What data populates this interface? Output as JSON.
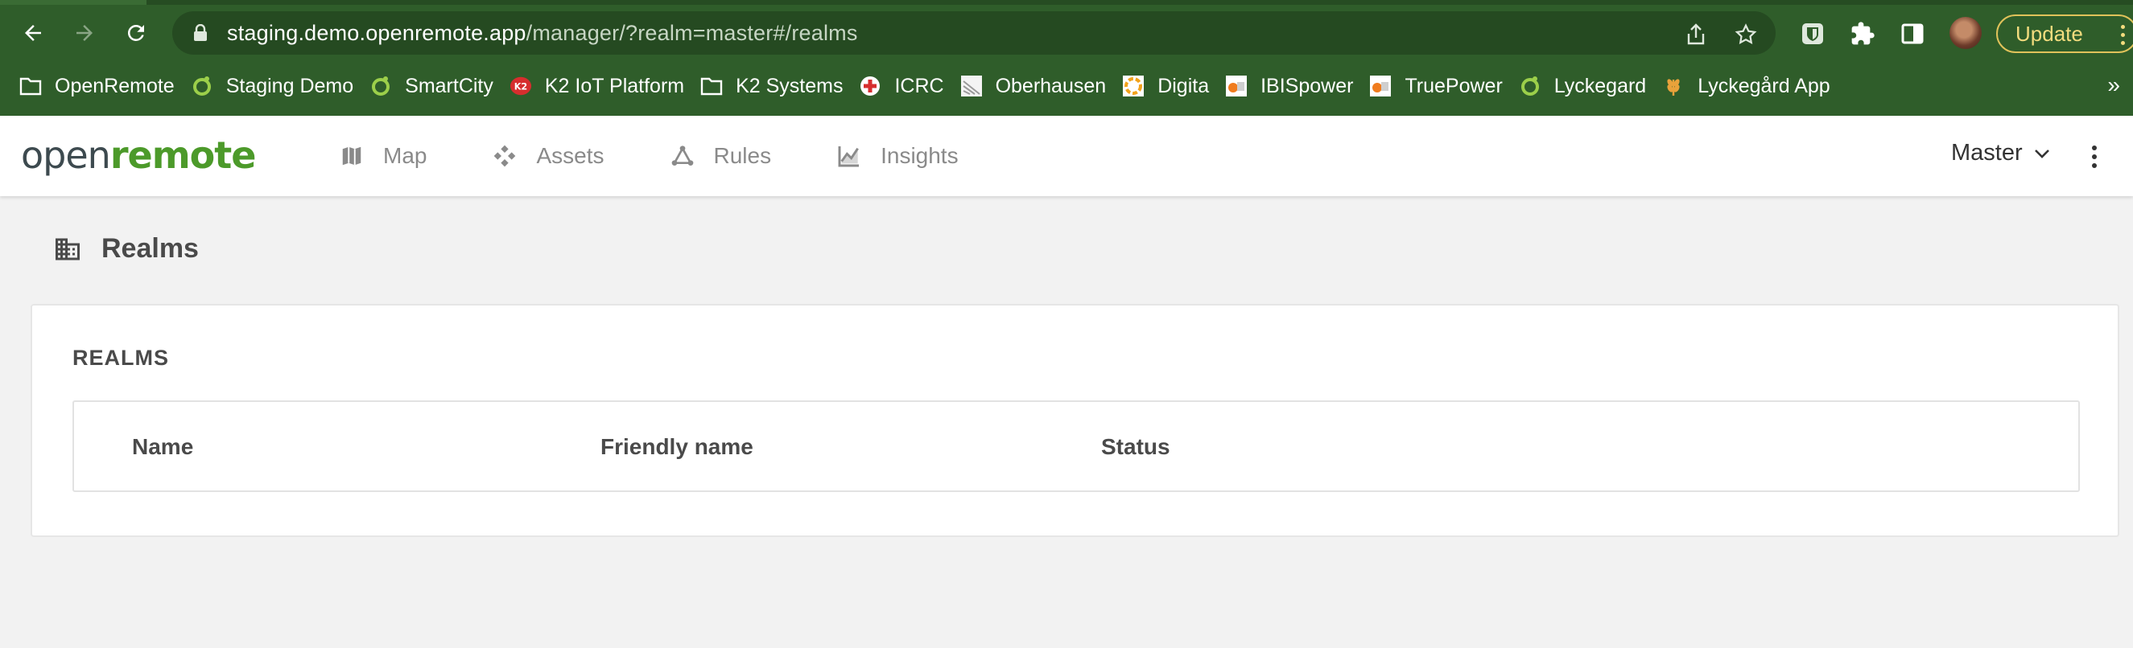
{
  "browser": {
    "url_host": "staging.demo.openremote.app",
    "url_path": "/manager/?realm=master#/realms",
    "update_label": "Update",
    "bookmarks": [
      {
        "label": "OpenRemote",
        "icon": "folder-icon"
      },
      {
        "label": "Staging Demo",
        "icon": "openremote-ring-icon"
      },
      {
        "label": "SmartCity",
        "icon": "openremote-ring-icon"
      },
      {
        "label": "K2 IoT Platform",
        "icon": "k2-logo-icon"
      },
      {
        "label": "K2 Systems",
        "icon": "folder-icon"
      },
      {
        "label": "ICRC",
        "icon": "red-cross-icon"
      },
      {
        "label": "Oberhausen",
        "icon": "oberhausen-icon"
      },
      {
        "label": "Digita",
        "icon": "digita-icon"
      },
      {
        "label": "IBISpower",
        "icon": "ibis-icon"
      },
      {
        "label": "TruePower",
        "icon": "ibis-icon"
      },
      {
        "label": "Lyckegard",
        "icon": "openremote-ring-icon"
      },
      {
        "label": "Lyckegård App",
        "icon": "wheat-icon"
      }
    ],
    "bookmarks_overflow": "»"
  },
  "header": {
    "logo_open": "open",
    "logo_remote": "remote",
    "nav": [
      {
        "label": "Map",
        "icon": "map-icon"
      },
      {
        "label": "Assets",
        "icon": "assets-icon"
      },
      {
        "label": "Rules",
        "icon": "rules-icon"
      },
      {
        "label": "Insights",
        "icon": "insights-icon"
      }
    ],
    "realm": "Master"
  },
  "page": {
    "title": "Realms",
    "panel_heading": "REALMS",
    "table_headers": [
      "Name",
      "Friendly name",
      "Status"
    ]
  },
  "colors": {
    "chrome_green": "#2f5d2a",
    "brand_green": "#4c9a2a",
    "background": "#f2f2f2"
  }
}
